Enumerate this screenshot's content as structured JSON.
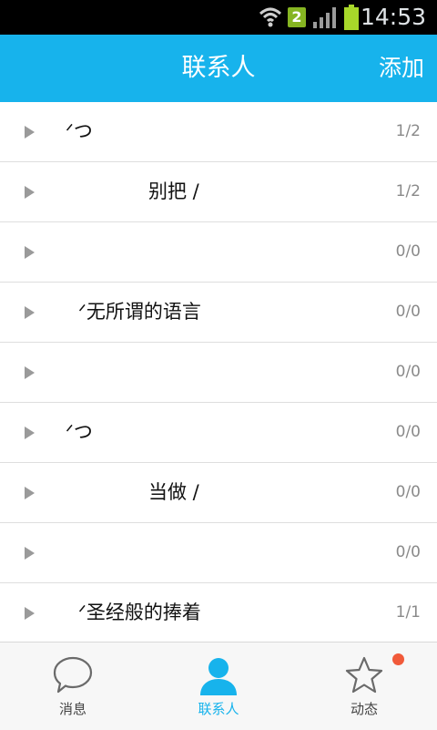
{
  "status_bar": {
    "time": "14:53",
    "sim_slot": "2",
    "icons": [
      "wifi-icon",
      "sim-2-icon",
      "signal-icon",
      "battery-icon"
    ]
  },
  "header": {
    "title": "联系人",
    "add_label": "添加"
  },
  "groups": [
    {
      "name": "ᐟつ",
      "count": "1/2"
    },
    {
      "name": "别把 /",
      "count": "1/2"
    },
    {
      "name": "",
      "count": "0/0"
    },
    {
      "name": "ᐟ无所谓的语言",
      "count": "0/0"
    },
    {
      "name": "",
      "count": "0/0"
    },
    {
      "name": "ᐟつ",
      "count": "0/0"
    },
    {
      "name": "当做 /",
      "count": "0/0"
    },
    {
      "name": "",
      "count": "0/0"
    },
    {
      "name": "ᐟ圣经般的捧着",
      "count": "1/1"
    }
  ],
  "tabs": [
    {
      "label": "消息",
      "icon": "chat-bubble-icon",
      "active": false
    },
    {
      "label": "联系人",
      "icon": "contact-person-icon",
      "active": true
    },
    {
      "label": "动态",
      "icon": "star-icon",
      "active": false
    }
  ],
  "colors": {
    "accent": "#17b3ec",
    "notification": "#f15a3a"
  }
}
